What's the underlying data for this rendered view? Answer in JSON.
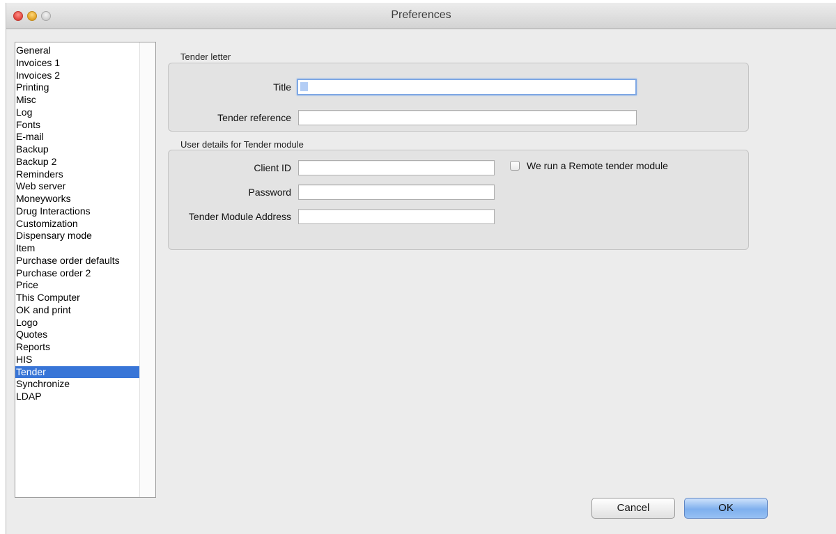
{
  "window": {
    "title": "Preferences"
  },
  "sidebar": {
    "items": [
      "General",
      "Invoices 1",
      "Invoices 2",
      "Printing",
      "Misc",
      "Log",
      "Fonts",
      "E-mail",
      "Backup",
      "Backup 2",
      "Reminders",
      "Web server",
      "Moneyworks",
      "Drug Interactions",
      "Customization",
      "Dispensary mode",
      "Item",
      "Purchase order defaults",
      "Purchase order 2",
      "Price",
      "This Computer",
      "OK and print",
      "Logo",
      "Quotes",
      "Reports",
      "HIS",
      "Tender",
      "Synchronize",
      "LDAP"
    ],
    "selected": "Tender"
  },
  "tender_letter": {
    "section_label": "Tender letter",
    "title_label": "Title",
    "title_value": "",
    "reference_label": "Tender reference",
    "reference_value": ""
  },
  "user_details": {
    "section_label": "User details for Tender module",
    "client_id_label": "Client ID",
    "client_id_value": "",
    "password_label": "Password",
    "password_value": "",
    "address_label": "Tender Module Address",
    "address_value": "",
    "remote_checkbox_label": "We run a Remote tender module",
    "remote_checkbox_checked": false
  },
  "buttons": {
    "cancel": "Cancel",
    "ok": "OK"
  }
}
